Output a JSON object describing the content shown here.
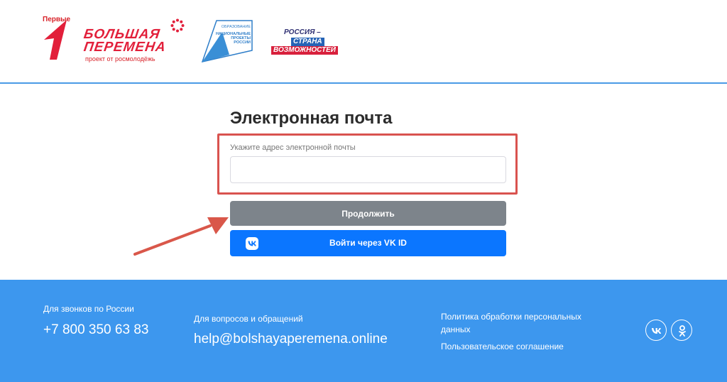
{
  "header": {
    "logo_pervye_text": "Первые",
    "logo_bp_line1": "БОЛЬШАЯ",
    "logo_bp_line2": "ПЕРЕМЕНА",
    "logo_bp_sub": "проект от росмолодёжь",
    "logo_np_line1": "ОБРАЗОВАНИЕ",
    "logo_np_line2": "НАЦИОНАЛЬНЫЕ ПРОЕКТЫ РОССИИ",
    "logo_rsv_line1": "РОССИЯ –",
    "logo_rsv_line2": "СТРАНА",
    "logo_rsv_line3": "ВОЗМОЖНОСТЕЙ"
  },
  "form": {
    "title": "Электронная почта",
    "email_label": "Укажите адрес электронной почты",
    "email_value": "",
    "continue_label": "Продолжить",
    "vk_label": "Войти через VK ID"
  },
  "footer": {
    "calls_label": "Для звонков по России",
    "phone": "+7 800 350 63 83",
    "questions_label": "Для вопросов и обращений",
    "email": "help@bolshayaperemena.online",
    "policy_link": "Политика обработки персональных данных",
    "terms_link": "Пользовательское соглашение",
    "social_icons": [
      "vk-icon",
      "odnoklassniki-icon"
    ]
  },
  "colors": {
    "brand_red": "#e21f3a",
    "continue_button": "#7d848b",
    "vk_button": "#0b76ff",
    "footer_bg": "#3d97ee",
    "highlight_border": "#d9534f"
  }
}
